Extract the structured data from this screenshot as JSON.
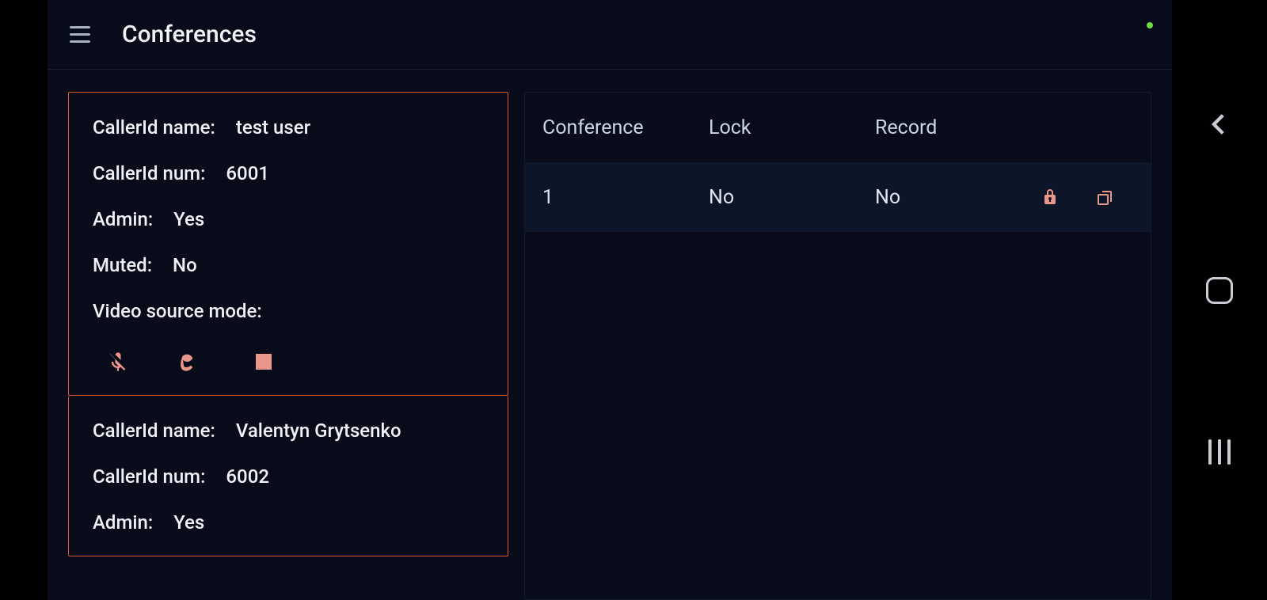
{
  "header": {
    "title": "Conferences"
  },
  "callers": [
    {
      "name_label": "CallerId name:",
      "name_value": "test user",
      "num_label": "CallerId num:",
      "num_value": "6001",
      "admin_label": "Admin:",
      "admin_value": "Yes",
      "muted_label": "Muted:",
      "muted_value": "No",
      "video_label": "Video source mode:",
      "video_value": ""
    },
    {
      "name_label": "CallerId name:",
      "name_value": "Valentyn Grytsenko",
      "num_label": "CallerId num:",
      "num_value": "6002",
      "admin_label": "Admin:",
      "admin_value": "Yes"
    }
  ],
  "table": {
    "headers": {
      "conference": "Conference",
      "lock": "Lock",
      "record": "Record"
    },
    "rows": [
      {
        "conference": "1",
        "lock": "No",
        "record": "No"
      }
    ]
  },
  "icons": {
    "mic_off": "mic-off-icon",
    "video": "video-icon",
    "stop": "stop-icon",
    "lock": "lock-icon",
    "record_list": "record-list-icon"
  },
  "colors": {
    "accent_border": "#d95a2a",
    "icon_pink": "#e8978a",
    "bg_dark": "#070b1a",
    "status_green": "#6fda44"
  }
}
